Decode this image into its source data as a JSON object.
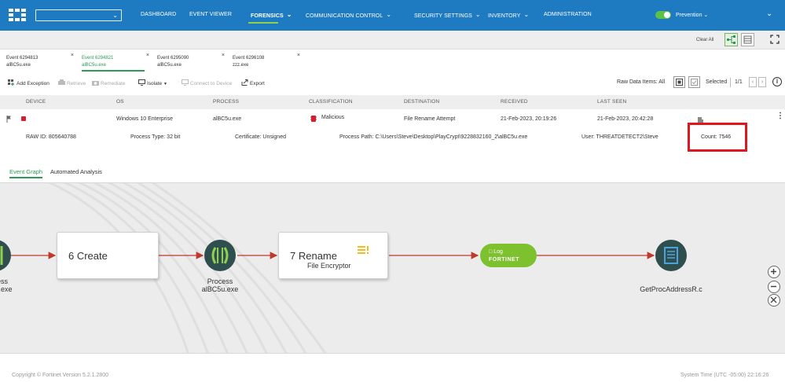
{
  "nav": {
    "org_select_value": "",
    "items": [
      {
        "label": "DASHBOARD",
        "has_caret": false
      },
      {
        "label": "EVENT VIEWER",
        "has_caret": false
      },
      {
        "label": "FORENSICS",
        "has_caret": true,
        "active": true
      },
      {
        "label": "COMMUNICATION CONTROL",
        "has_caret": true
      },
      {
        "label": "SECURITY SETTINGS",
        "has_caret": true
      },
      {
        "label": "INVENTORY",
        "has_caret": true
      },
      {
        "label": "ADMINISTRATION",
        "has_caret": false
      }
    ],
    "mode_label": "Prevention",
    "mode_enabled": true
  },
  "subbar": {
    "clear_all": "Clear All"
  },
  "tabs": [
    {
      "line1": "Event 6294813",
      "line2": "alBC5u.exe",
      "active": false
    },
    {
      "line1": "Event 6294821",
      "line2": "alBC5u.exe",
      "active": true
    },
    {
      "line1": "Event 6295090",
      "line2": "alBC5u.exe",
      "active": false
    },
    {
      "line1": "Event 6296108",
      "line2": "zzz.exe",
      "active": false
    }
  ],
  "actions": {
    "add_exception": "Add Exception",
    "retrieve": "Retrieve",
    "remediate": "Remediate",
    "isolate": "Isolate",
    "connect": "Connect to Device",
    "export": "Export",
    "raw_data": "Raw Data Items: All",
    "selected": "Selected",
    "pager": "1/1"
  },
  "table": {
    "headers": [
      "DEVICE",
      "OS",
      "PROCESS",
      "CLASSIFICATION",
      "DESTINATION",
      "RECEIVED",
      "LAST SEEN"
    ],
    "row": {
      "os": "Windows 10 Enterprise",
      "process": "alBC5u.exe",
      "classification": "Malicious",
      "destination": "File Rename Attempt",
      "received": "21-Feb-2023, 20:19:26",
      "last_seen": "21-Feb-2023, 20:42:28"
    },
    "details": {
      "raw_id": "RAW ID: 805640788",
      "process_type": "Process Type: 32 bit",
      "certificate": "Certificate: Unsigned",
      "process_path": "Process Path: C:\\Users\\Steve\\Desktop\\PlayCrypt\\9228832160_2\\alBC5u.exe",
      "user": "User: THREATDETECT2\\Steve",
      "count": "Count: 7546"
    }
  },
  "subtabs": [
    "Event Graph",
    "Automated Analysis"
  ],
  "graph": {
    "left_label_line1": "ess",
    "left_label_line2": "r.exe",
    "create_box": "6 Create",
    "process_label_line1": "Process",
    "process_label_line2": "alBC5u.exe",
    "rename_box_title": "7 Rename",
    "rename_box_sub": "File Encryptor",
    "log_label": "Log",
    "log_brand": "FORTINET",
    "target_label": "GetProcAddressR.c"
  },
  "footer": {
    "copyright": "Copyright © Fortinet Version 5.2.1.2800",
    "system_time": "System Time (UTC -05:00) 22:16:26"
  },
  "colors": {
    "nav_bg": "#1f7bc1",
    "accent_green": "#2e9a5a",
    "malicious_red": "#d32030",
    "highlight_red": "#e0161f",
    "edge_red": "#c0392b",
    "log_green": "#7dc22e"
  }
}
